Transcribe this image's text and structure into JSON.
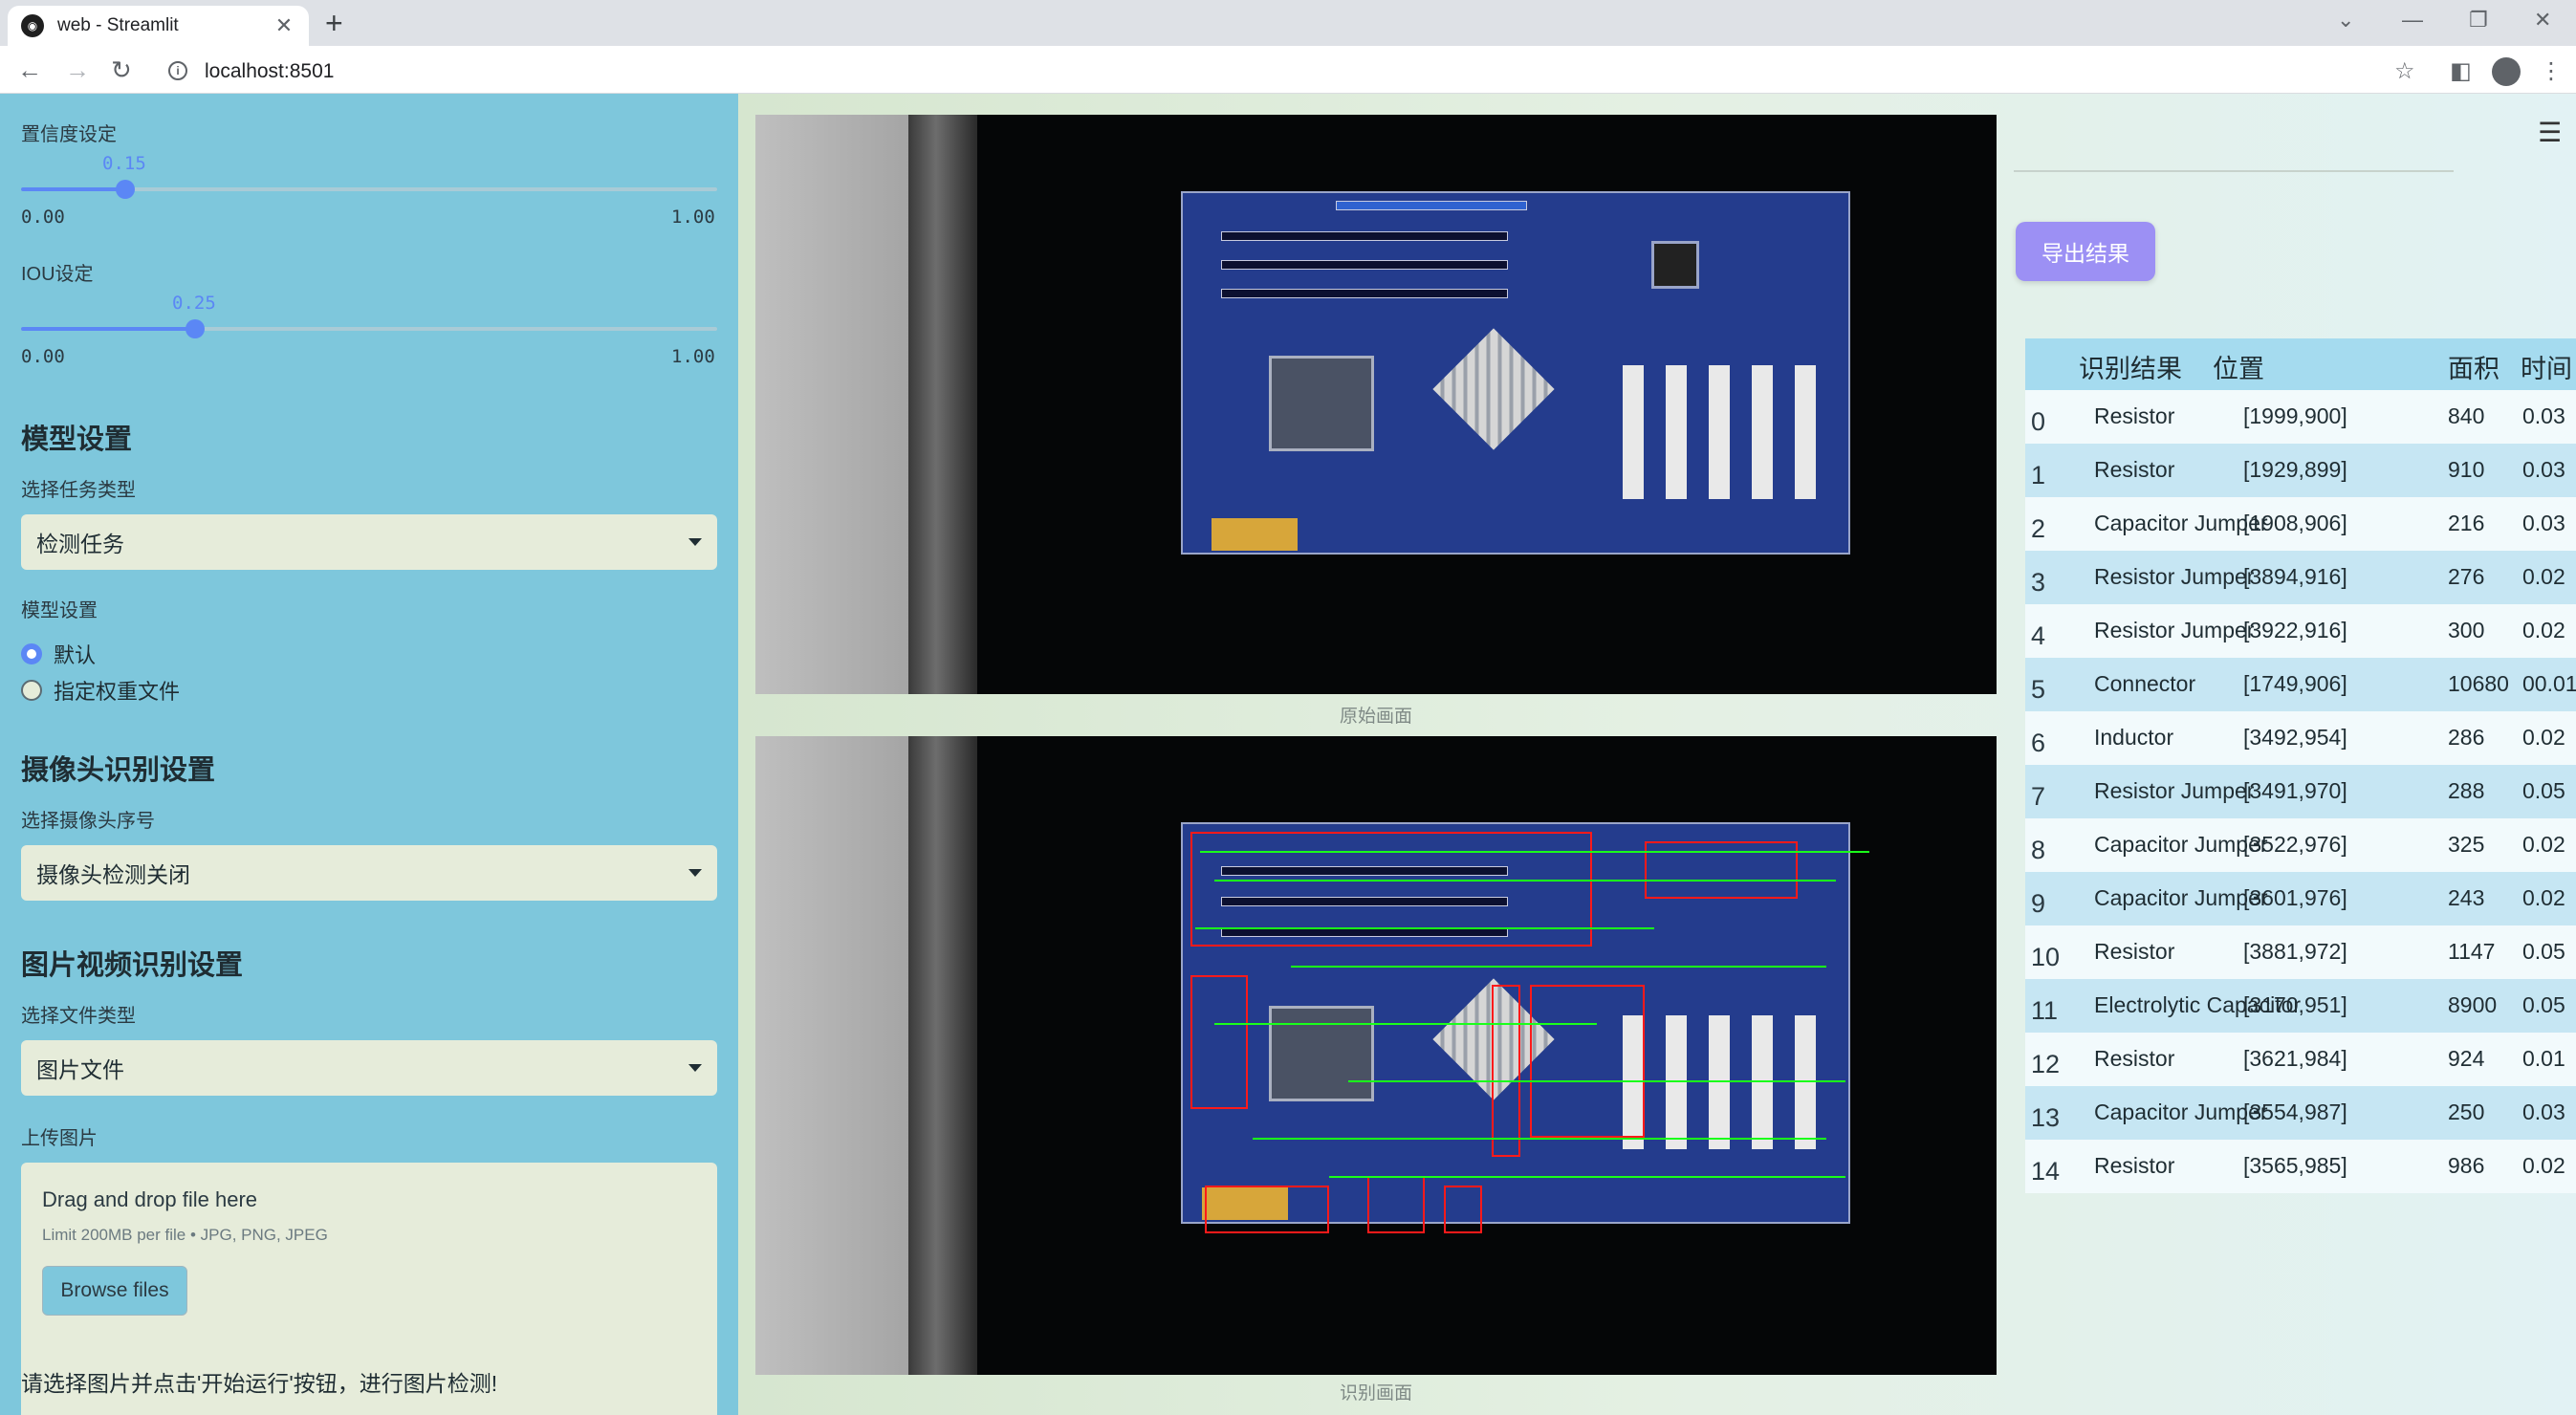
{
  "browser": {
    "tab_title": "web - Streamlit",
    "url": "localhost:8501"
  },
  "sidebar": {
    "confidence": {
      "label": "置信度设定",
      "value": "0.15",
      "min": "0.00",
      "max": "1.00",
      "fraction": 0.15
    },
    "iou": {
      "label": "IOU设定",
      "value": "0.25",
      "min": "0.00",
      "max": "1.00",
      "fraction": 0.25
    },
    "model_section": {
      "heading": "模型设置",
      "task_label": "选择任务类型",
      "task_value": "检测任务",
      "model_label": "模型设置",
      "radio_default": "默认",
      "radio_custom": "指定权重文件"
    },
    "camera_section": {
      "heading": "摄像头识别设置",
      "camera_label": "选择摄像头序号",
      "camera_value": "摄像头检测关闭"
    },
    "media_section": {
      "heading": "图片视频识别设置",
      "file_type_label": "选择文件类型",
      "file_type_value": "图片文件",
      "upload_label": "上传图片",
      "drop_text": "Drag and drop file here",
      "limit_text": "Limit 200MB per file • JPG, PNG, JPEG",
      "browse_label": "Browse files"
    },
    "hint": "请选择图片并点击'开始运行'按钮，进行图片检测!"
  },
  "main": {
    "original_caption": "原始画面",
    "detected_caption": "识别画面",
    "export_label": "导出结果",
    "menu_icon": "hamburger-menu-icon"
  },
  "results": {
    "headers": [
      "识别结果",
      "位置",
      "面积",
      "时间"
    ],
    "rows": [
      {
        "idx": "0",
        "label": "Resistor",
        "pos": "[1999,900]",
        "area": "840",
        "time": "0.03"
      },
      {
        "idx": "1",
        "label": "Resistor",
        "pos": "[1929,899]",
        "area": "910",
        "time": "0.03"
      },
      {
        "idx": "2",
        "label": "Capacitor Jumper",
        "pos": "[1908,906]",
        "area": "216",
        "time": "0.03"
      },
      {
        "idx": "3",
        "label": "Resistor Jumper",
        "pos": "[3894,916]",
        "area": "276",
        "time": "0.02"
      },
      {
        "idx": "4",
        "label": "Resistor Jumper",
        "pos": "[3922,916]",
        "area": "300",
        "time": "0.02"
      },
      {
        "idx": "5",
        "label": "Connector",
        "pos": "[1749,906]",
        "area": "10680",
        "time": "00.01"
      },
      {
        "idx": "6",
        "label": "Inductor",
        "pos": "[3492,954]",
        "area": "286",
        "time": "0.02"
      },
      {
        "idx": "7",
        "label": "Resistor Jumper",
        "pos": "[3491,970]",
        "area": "288",
        "time": "0.05"
      },
      {
        "idx": "8",
        "label": "Capacitor Jumper",
        "pos": "[3522,976]",
        "area": "325",
        "time": "0.02"
      },
      {
        "idx": "9",
        "label": "Capacitor Jumper",
        "pos": "[3601,976]",
        "area": "243",
        "time": "0.02"
      },
      {
        "idx": "10",
        "label": "Resistor",
        "pos": "[3881,972]",
        "area": "1147",
        "time": "0.05"
      },
      {
        "idx": "11",
        "label": "Electrolytic Capacitor",
        "pos": "[3170,951]",
        "area": "8900",
        "time": "0.05"
      },
      {
        "idx": "12",
        "label": "Resistor",
        "pos": "[3621,984]",
        "area": "924",
        "time": "0.01"
      },
      {
        "idx": "13",
        "label": "Capacitor Jumper",
        "pos": "[3554,987]",
        "area": "250",
        "time": "0.03"
      },
      {
        "idx": "14",
        "label": "Resistor",
        "pos": "[3565,985]",
        "area": "986",
        "time": "0.02"
      }
    ]
  },
  "colors": {
    "sidebar_bg": "#7ec7dc",
    "accent": "#5b87f5",
    "export_button": "#9c90f4",
    "detection_box": "#ff1a1a",
    "detection_line": "#1aff1a"
  }
}
